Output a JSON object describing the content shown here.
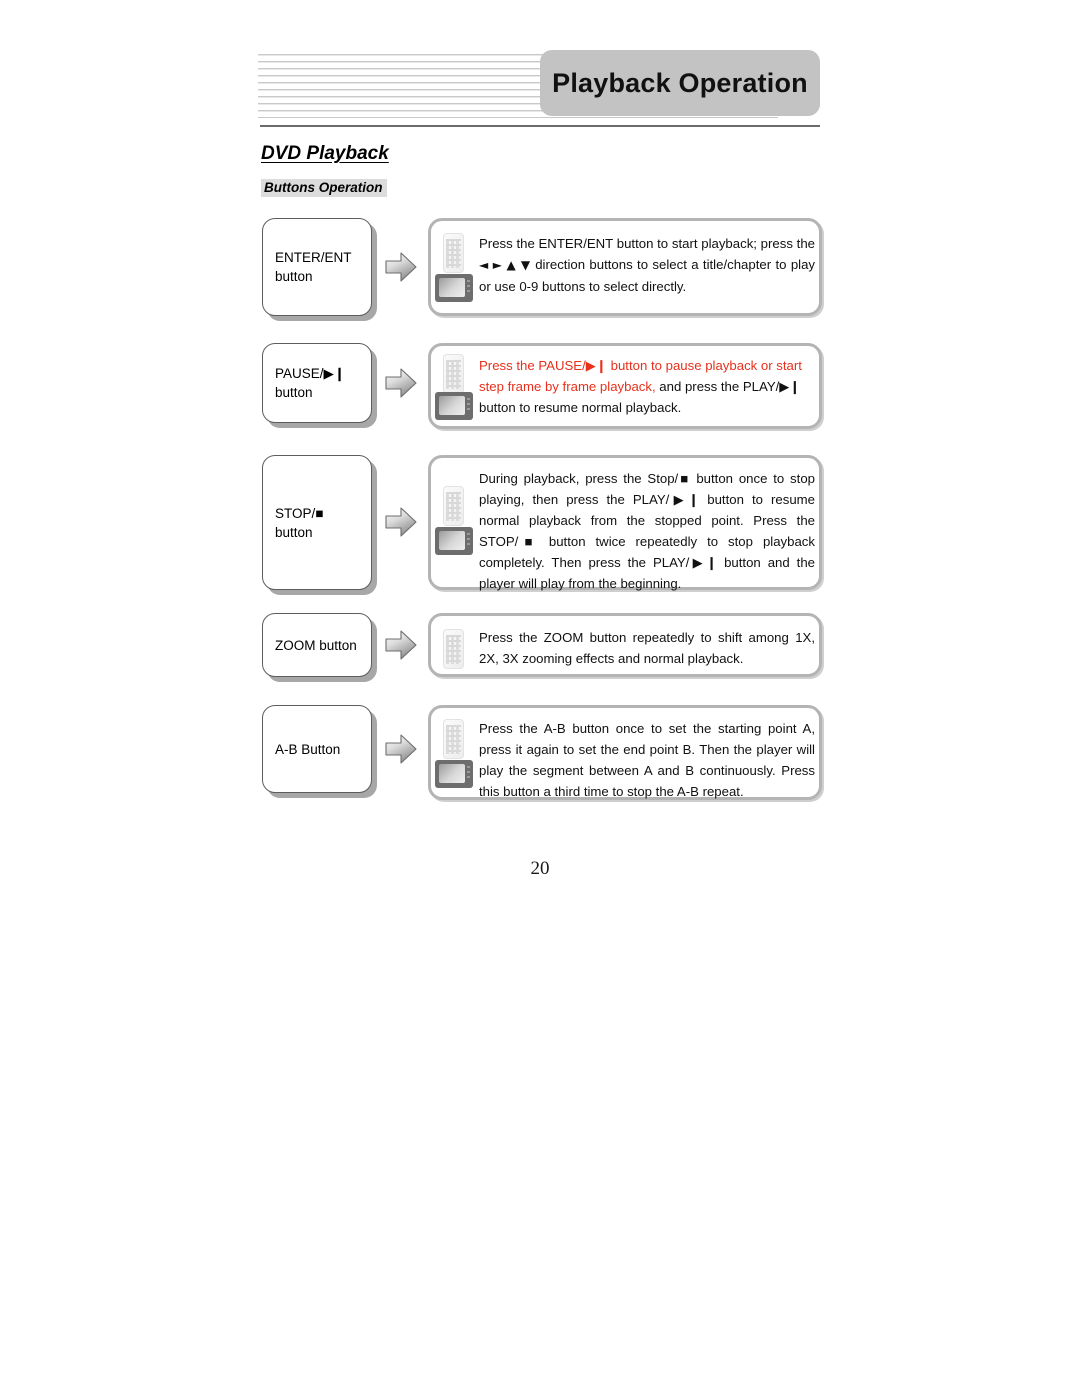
{
  "header": {
    "title": "Playback Operation"
  },
  "section": {
    "title": "DVD Playback",
    "subtitle": "Buttons Operation"
  },
  "colors": {
    "header_tab_bg": "#c3c3c3",
    "subtitle_bg": "#dcdcdc",
    "highlight_text": "#e8301c",
    "box_border": "#b4b4b4",
    "label_border": "#5d5d5d"
  },
  "rows": [
    {
      "label": "ENTER/ENT\nbutton",
      "icons": [
        "remote-control-icon",
        "tv-screen-icon"
      ],
      "description": "Press the ENTER/ENT button to start playback; press the ◄ ► ▲ ▼ direction buttons to select a title/chapter to play or use 0-9 buttons to select directly.",
      "description_plain": "Press the ENTER/ENT button to start playback; press the direction buttons to select a title/chapter to play or use 0-9 buttons to select directly.",
      "direction_glyphs": "◄ ► ▲ ▼"
    },
    {
      "label": "PAUSE/▶❙\nbutton",
      "icons": [
        "remote-control-icon",
        "tv-screen-icon"
      ],
      "highlight_part": "Press the PAUSE/▶❙ button to pause playback or start step frame by frame playback,",
      "normal_part": " and press the PLAY/▶❙ button to resume normal playback.",
      "description": "Press the PAUSE/▶❙ button to pause playback or start step frame by frame playback, and press the PLAY/▶❙ button to resume normal playback."
    },
    {
      "label": "STOP/■\nbutton",
      "icons": [
        "remote-control-icon",
        "tv-screen-icon"
      ],
      "description": "During playback, press the Stop/■ button once to stop playing, then press the PLAY/▶❙ button to resume normal playback from the stopped point. Press the STOP/■ button twice repeatedly to stop playback completely. Then press the PLAY/▶❙ button and the player will play from the beginning."
    },
    {
      "label": "ZOOM button",
      "icons": [
        "remote-control-icon"
      ],
      "description": "Press the ZOOM button repeatedly to shift among 1X, 2X, 3X zooming effects and normal playback."
    },
    {
      "label": "A-B Button",
      "icons": [
        "remote-control-icon",
        "tv-screen-icon"
      ],
      "description": "Press the A-B button once to set the starting point A, press it again to set the end point B. Then the player will play the segment between A and B continuously. Press this button a third time to stop the A-B repeat."
    }
  ],
  "footer": {
    "page_number": "20"
  }
}
